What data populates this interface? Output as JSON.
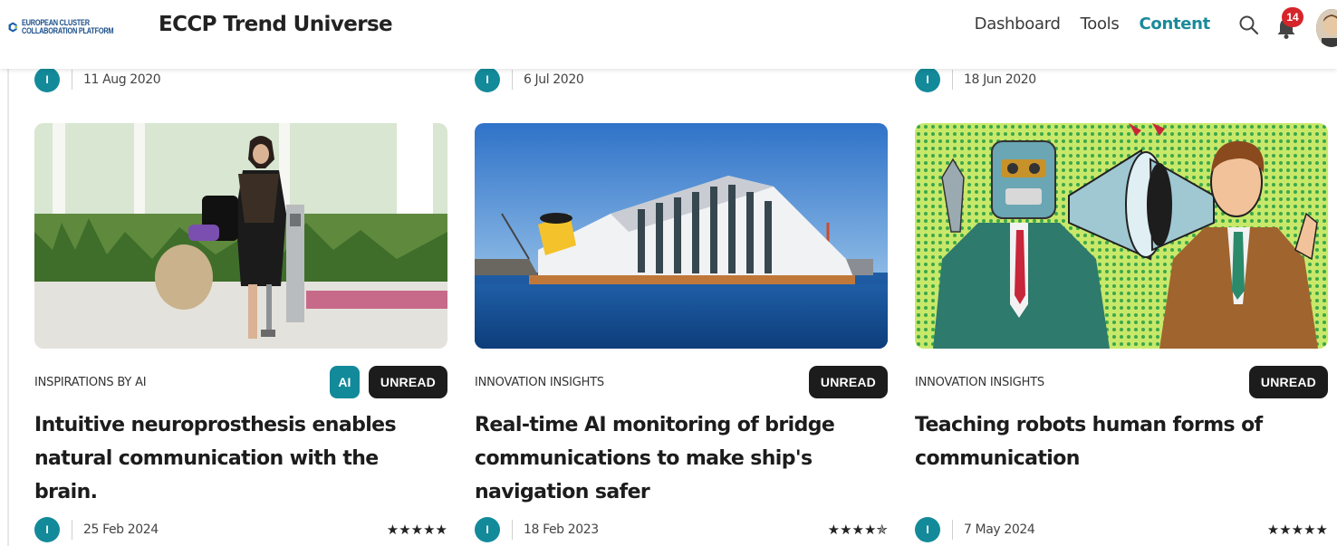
{
  "header": {
    "logo_text_line1": "EUROPEAN CLUSTER",
    "logo_text_line2": "COLLABORATION PLATFORM",
    "app_title": "ECCP Trend Universe",
    "nav": [
      {
        "label": "Dashboard",
        "active": false
      },
      {
        "label": "Tools",
        "active": false
      },
      {
        "label": "Content",
        "active": true
      }
    ],
    "notification_count": "14"
  },
  "top_meta": [
    {
      "avatar_initial": "I",
      "date": "11 Aug 2020"
    },
    {
      "avatar_initial": "I",
      "date": "6 Jul 2020"
    },
    {
      "avatar_initial": "I",
      "date": "18 Jun 2020"
    }
  ],
  "cards": [
    {
      "image": "woman-with-prosthetic-leg",
      "category": "INSPIRATIONS BY AI",
      "ai_badge": "AI",
      "status": "UNREAD",
      "title": "Intuitive neuroprosthesis enables natural communication with the brain.",
      "avatar_initial": "I",
      "date": "25 Feb 2024",
      "rating": 5,
      "stars": "★★★★★"
    },
    {
      "image": "capsized-cruise-ship",
      "category": "INNOVATION INSIGHTS",
      "ai_badge": null,
      "status": "UNREAD",
      "title": "Real-time AI monitoring of bridge communications to make ship's navigation safer",
      "avatar_initial": "I",
      "date": "18 Feb 2023",
      "rating": 4.5,
      "stars": "★★★★✯"
    },
    {
      "image": "robot-and-man-with-megaphones",
      "category": "INNOVATION INSIGHTS",
      "ai_badge": null,
      "status": "UNREAD",
      "title": "Teaching robots human forms of communication",
      "avatar_initial": "I",
      "date": "7 May 2024",
      "rating": 5,
      "stars": "★★★★★"
    }
  ],
  "colors": {
    "accent": "#138a9a",
    "nav_active": "#1a8a9a",
    "badge_dark": "#1c1c1c",
    "notification": "#d6242b"
  }
}
